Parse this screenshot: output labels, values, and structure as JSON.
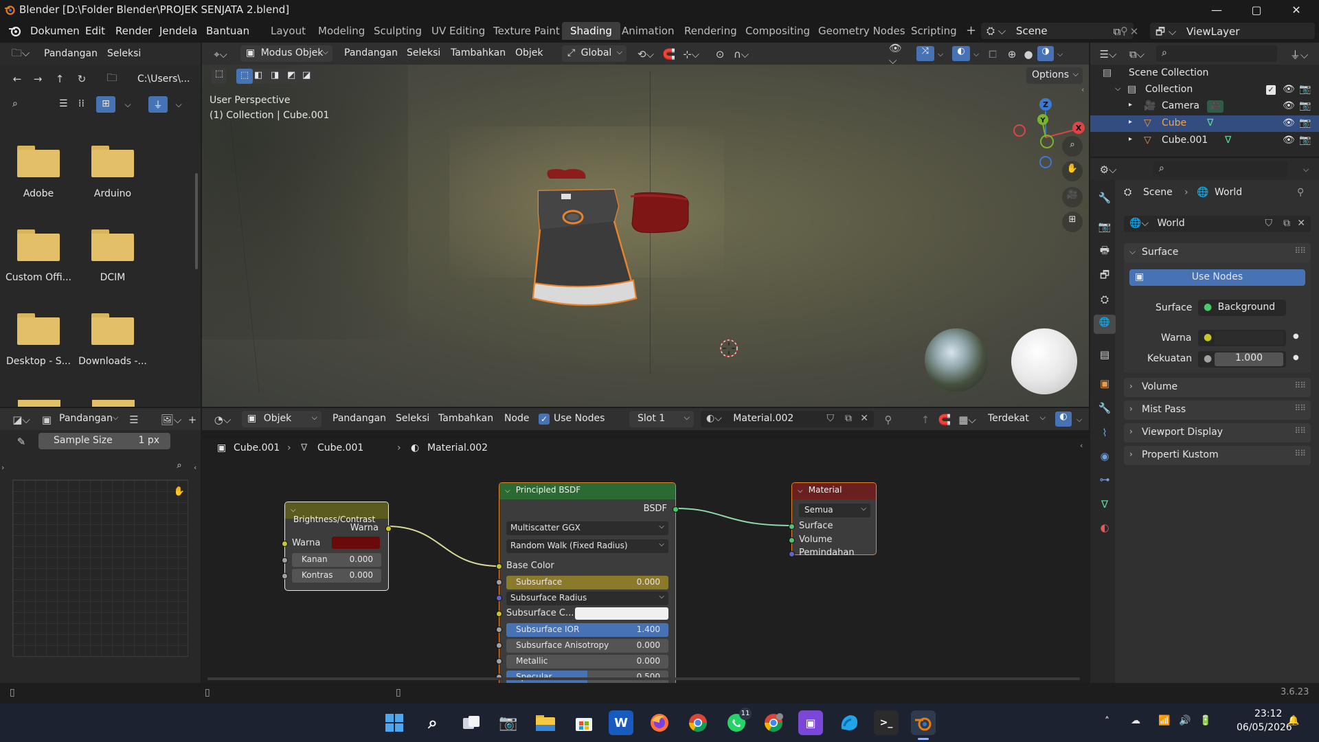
{
  "window": {
    "title": "Blender [D:\\Folder Blender\\PROJEK SENJATA 2.blend]",
    "minimize": "—",
    "maximize": "▢",
    "close": "✕"
  },
  "menu": {
    "items": [
      "Dokumen",
      "Edit",
      "Render",
      "Jendela",
      "Bantuan"
    ]
  },
  "workspaces": {
    "tabs": [
      "Layout",
      "Modeling",
      "Sculpting",
      "UV Editing",
      "Texture Paint",
      "Shading",
      "Animation",
      "Rendering",
      "Compositing",
      "Geometry Nodes",
      "Scripting"
    ],
    "active": "Shading",
    "add": "+"
  },
  "scene": {
    "name": "Scene",
    "viewlayer": "ViewLayer"
  },
  "file_browser": {
    "header": [
      "Pandangan",
      "Seleksi"
    ],
    "path": "C:\\Users\\...",
    "folders": [
      "Adobe",
      "Arduino",
      "Custom Offi...",
      "DCIM",
      "Desktop - S...",
      "Downloads -..."
    ]
  },
  "viewport": {
    "mode": "Modus Objek",
    "menus": [
      "Pandangan",
      "Seleksi",
      "Tambahkan",
      "Objek"
    ],
    "orientation": "Global",
    "options": "Options",
    "perspective": "User Perspective",
    "collection_info": "(1) Collection | Cube.001",
    "gizmo": {
      "x": "X",
      "y": "Y",
      "z": "Z"
    }
  },
  "image_editor": {
    "header": [
      "Pandangan"
    ],
    "sample_label": "Sample Size",
    "sample_value": "1 px"
  },
  "node_editor": {
    "object_mode": "Objek",
    "menus": [
      "Pandangan",
      "Seleksi",
      "Tambahkan",
      "Node"
    ],
    "use_nodes": "Use Nodes",
    "slot": "Slot 1",
    "material": "Material.002",
    "snap": "Terdekat",
    "breadcrumb": [
      "Cube.001",
      "Cube.001",
      "Material.002"
    ],
    "nodes": {
      "brightness": {
        "title": "Brightness/Contrast",
        "output": "Warna",
        "color_label": "Warna",
        "color": "#6b0a0a",
        "kanan_label": "Kanan",
        "kanan_value": "0.000",
        "kontras_label": "Kontras",
        "kontras_value": "0.000"
      },
      "principled": {
        "title": "Principled BSDF",
        "output": "BSDF",
        "distribution": "Multiscatter GGX",
        "subsurface_method": "Random Walk (Fixed Radius)",
        "base_color": "Base Color",
        "subsurface_label": "Subsurface",
        "subsurface_value": "0.000",
        "subsurface_radius": "Subsurface Radius",
        "subsurface_color": "Subsurface C...",
        "subsurface_ior_label": "Subsurface IOR",
        "subsurface_ior_value": "1.400",
        "anisotropy_label": "Subsurface Anisotropy",
        "anisotropy_value": "0.000",
        "metallic_label": "Metallic",
        "metallic_value": "0.000",
        "specular_label": "Specular",
        "specular_value": "0.500",
        "specular_fill": 0.5
      },
      "material": {
        "title": "Material",
        "target": "Semua",
        "surface": "Surface",
        "volume": "Volume",
        "displacement": "Pemindahan"
      }
    }
  },
  "outliner": {
    "root": "Scene Collection",
    "collection": "Collection",
    "items": [
      "Camera",
      "Cube",
      "Cube.001"
    ]
  },
  "properties": {
    "breadcrumb": [
      "Scene",
      "World"
    ],
    "world_name": "World",
    "surface_section": "Surface",
    "use_nodes": "Use Nodes",
    "surface_label": "Surface",
    "surface_value": "Background",
    "warna_label": "Warna",
    "kekuatan_label": "Kekuatan",
    "kekuatan_value": "1.000",
    "sections": [
      "Volume",
      "Mist Pass",
      "Viewport Display",
      "Properti Kustom"
    ]
  },
  "status": {
    "version": "3.6.23"
  },
  "taskbar": {
    "time": "23:12",
    "date": "06/05/2026",
    "whatsapp_badge": "11"
  }
}
